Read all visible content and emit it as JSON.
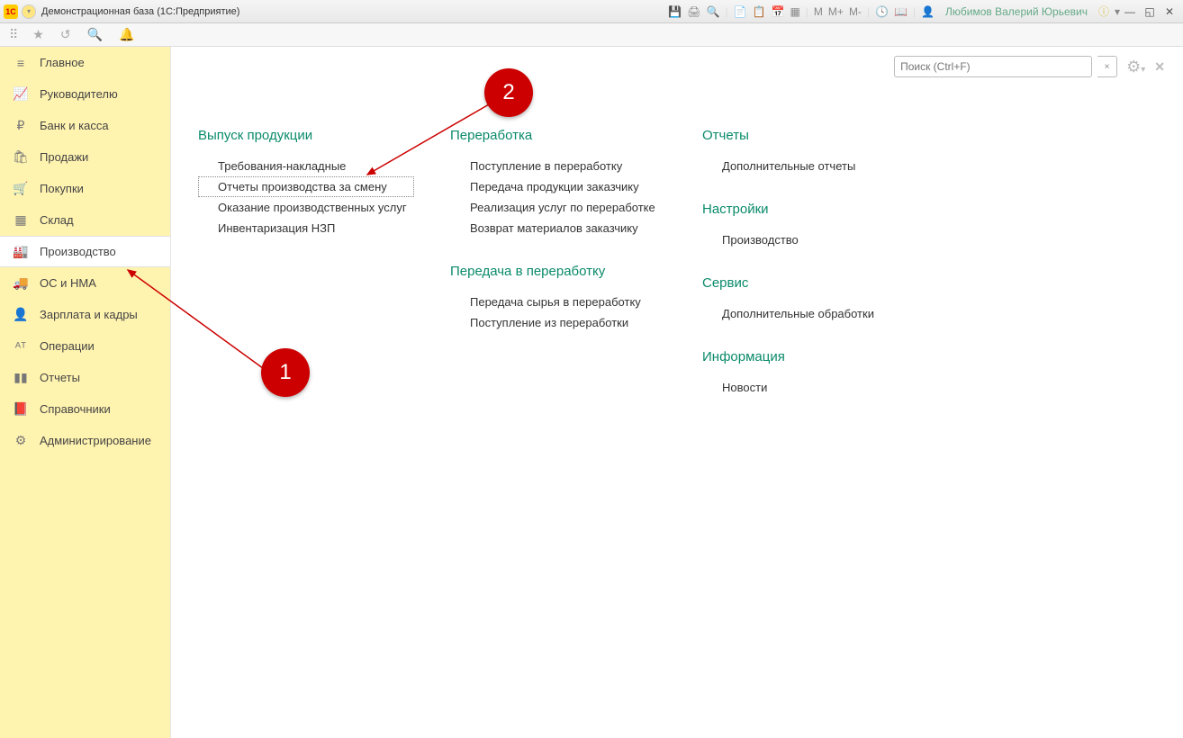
{
  "titlebar": {
    "app_logo_text": "1C",
    "title": "Демонстрационная база  (1С:Предприятие)",
    "m_label": "M",
    "mplus_label": "M+",
    "mminus_label": "M-",
    "user_name": "Любимов Валерий Юрьевич"
  },
  "search": {
    "placeholder": "Поиск (Ctrl+F)",
    "clear": "×"
  },
  "sidebar": {
    "items": [
      {
        "label": "Главное",
        "icon": "≡"
      },
      {
        "label": "Руководителю",
        "icon": "📈"
      },
      {
        "label": "Банк и касса",
        "icon": "₽"
      },
      {
        "label": "Продажи",
        "icon": "🛍"
      },
      {
        "label": "Покупки",
        "icon": "🛒"
      },
      {
        "label": "Склад",
        "icon": "▦"
      },
      {
        "label": "Производство",
        "icon": "🏭"
      },
      {
        "label": "ОС и НМА",
        "icon": "🚚"
      },
      {
        "label": "Зарплата и кадры",
        "icon": "👤"
      },
      {
        "label": "Операции",
        "icon": "ᴬᵀ"
      },
      {
        "label": "Отчеты",
        "icon": "▮▮"
      },
      {
        "label": "Справочники",
        "icon": "📕"
      },
      {
        "label": "Администрирование",
        "icon": "⚙"
      }
    ]
  },
  "sections": {
    "col1": {
      "h1": "Выпуск продукции",
      "links1": [
        "Требования-накладные",
        "Отчеты производства за смену",
        "Оказание производственных услуг",
        "Инвентаризация НЗП"
      ]
    },
    "col2": {
      "h1": "Переработка",
      "links1": [
        "Поступление в переработку",
        "Передача продукции заказчику",
        "Реализация услуг по переработке",
        "Возврат материалов заказчику"
      ],
      "h2": "Передача в переработку",
      "links2": [
        "Передача сырья в переработку",
        "Поступление из переработки"
      ]
    },
    "col3": {
      "h1": "Отчеты",
      "links1": [
        "Дополнительные отчеты"
      ],
      "h2": "Настройки",
      "links2": [
        "Производство"
      ],
      "h3": "Сервис",
      "links3": [
        "Дополнительные обработки"
      ],
      "h4": "Информация",
      "links4": [
        "Новости"
      ]
    }
  },
  "callouts": {
    "c1": "1",
    "c2": "2"
  }
}
